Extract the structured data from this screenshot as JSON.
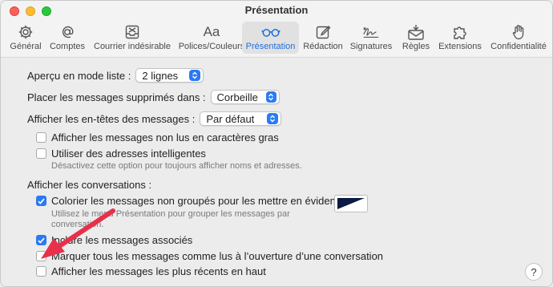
{
  "window": {
    "title": "Présentation"
  },
  "toolbar": {
    "items": [
      {
        "label": "Général",
        "icon": "gear-icon"
      },
      {
        "label": "Comptes",
        "icon": "at-icon"
      },
      {
        "label": "Courrier indésirable",
        "icon": "junk-tray-icon"
      },
      {
        "label": "Polices/Couleurs",
        "icon": "fonts-icon",
        "glyph": "Aa"
      },
      {
        "label": "Présentation",
        "icon": "glasses-icon",
        "selected": true
      },
      {
        "label": "Rédaction",
        "icon": "compose-icon"
      },
      {
        "label": "Signatures",
        "icon": "signature-icon"
      },
      {
        "label": "Règles",
        "icon": "rules-envelope-icon"
      },
      {
        "label": "Extensions",
        "icon": "puzzle-icon"
      },
      {
        "label": "Confidentialité",
        "icon": "hand-icon"
      }
    ]
  },
  "settings": {
    "list_preview": {
      "label": "Aperçu en mode liste :",
      "value": "2 lignes"
    },
    "deleted_messages": {
      "label": "Placer les messages supprimés dans :",
      "value": "Corbeille"
    },
    "headers": {
      "label": "Afficher les en-têtes des messages :",
      "value": "Par défaut"
    },
    "unread_bold": {
      "label": "Afficher les messages non lus en caractères gras",
      "checked": false
    },
    "smart_addresses": {
      "label": "Utiliser des adresses intelligentes",
      "checked": false,
      "note": "Désactivez cette option pour toujours afficher noms et adresses."
    },
    "conversations_heading": "Afficher les conversations :",
    "highlight_ungrouped": {
      "label": "Colorier les messages non groupés pour les mettre en évidence",
      "checked": true,
      "note_line1": "Utilisez le menu Présentation pour grouper les messages par",
      "note_line2": "conversation."
    },
    "include_related": {
      "label": "Inclure les messages associés",
      "checked": true
    },
    "mark_read": {
      "label": "Marquer tous les messages comme lus à l’ouverture d’une conversation",
      "checked": false
    },
    "recent_top": {
      "label": "Afficher les messages les plus récents en haut",
      "checked": false
    }
  },
  "help": {
    "label": "?"
  },
  "colors": {
    "accent": "#2a7af5",
    "highlight_swatch": "#0a1a44",
    "annotation_arrow": "#e8304a"
  }
}
